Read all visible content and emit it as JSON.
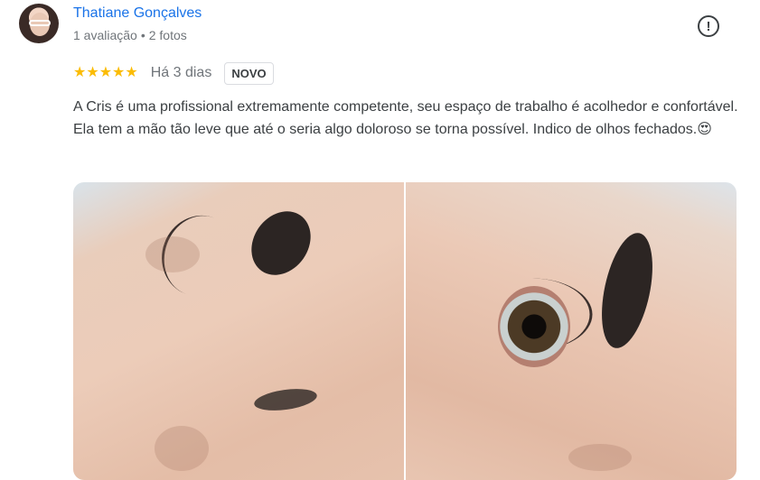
{
  "review": {
    "author": "Thatiane Gonçalves",
    "reviews_count": "1 avaliação",
    "photos_count": "2 fotos",
    "separator": "•",
    "rating": 5,
    "stars": "★★★★★",
    "date": "Há 3 dias",
    "badge": "NOVO",
    "text": "A Cris é uma profissional extremamente competente, seu espaço de trabalho é acolhedor e confortável. Ela tem a mão tão leve que até o seria algo doloroso se torna possível. Indico de olhos fechados.😍"
  },
  "icons": {
    "report": "report-icon",
    "star": "star-icon"
  },
  "colors": {
    "author_link": "#1a73e8",
    "star": "#fbbc04",
    "secondary_text": "#70757a",
    "body_text": "#3c4043"
  }
}
